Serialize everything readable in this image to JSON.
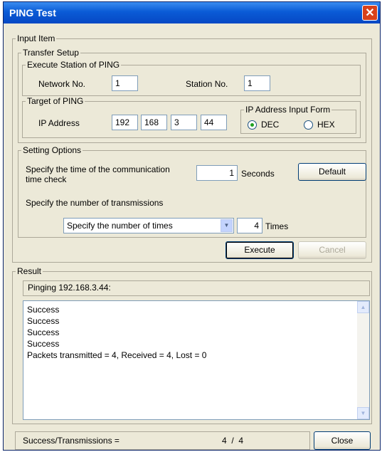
{
  "window": {
    "title": "PING Test"
  },
  "input_item": {
    "legend": "Input Item",
    "transfer_setup": {
      "legend": "Transfer Setup",
      "execute_station": {
        "legend": "Execute Station of PING",
        "network_label": "Network No.",
        "network_value": "1",
        "station_label": "Station No.",
        "station_value": "1"
      },
      "target": {
        "legend": "Target of PING",
        "ip_label": "IP Address",
        "ip": [
          "192",
          "168",
          "3",
          "44"
        ],
        "input_form": {
          "legend": "IP Address Input Form",
          "dec_label": "DEC",
          "hex_label": "HEX",
          "selected": "DEC"
        }
      }
    },
    "setting_options": {
      "legend": "Setting Options",
      "timecheck_label_line1": "Specify the time of the communication",
      "timecheck_label_line2": "time check",
      "timecheck_value": "1",
      "seconds_label": "Seconds",
      "default_button": "Default",
      "transmissions_label": "Specify the number of transmissions",
      "mode_selected": "Specify the number of times",
      "times_value": "4",
      "times_label": "Times"
    },
    "execute_button": "Execute",
    "cancel_button": "Cancel"
  },
  "result": {
    "legend": "Result",
    "pinging_text": "Pinging 192.168.3.44:",
    "lines": [
      "Success",
      "Success",
      "Success",
      "Success",
      "Packets transmitted = 4, Received = 4, Lost = 0"
    ]
  },
  "status": {
    "label": "Success/Transmissions =",
    "value": "4  /  4",
    "close_button": "Close"
  },
  "colors": {
    "titlebar": "#0a5bd6",
    "dialog_bg": "#ece9d8",
    "close_red": "#d8411b"
  }
}
